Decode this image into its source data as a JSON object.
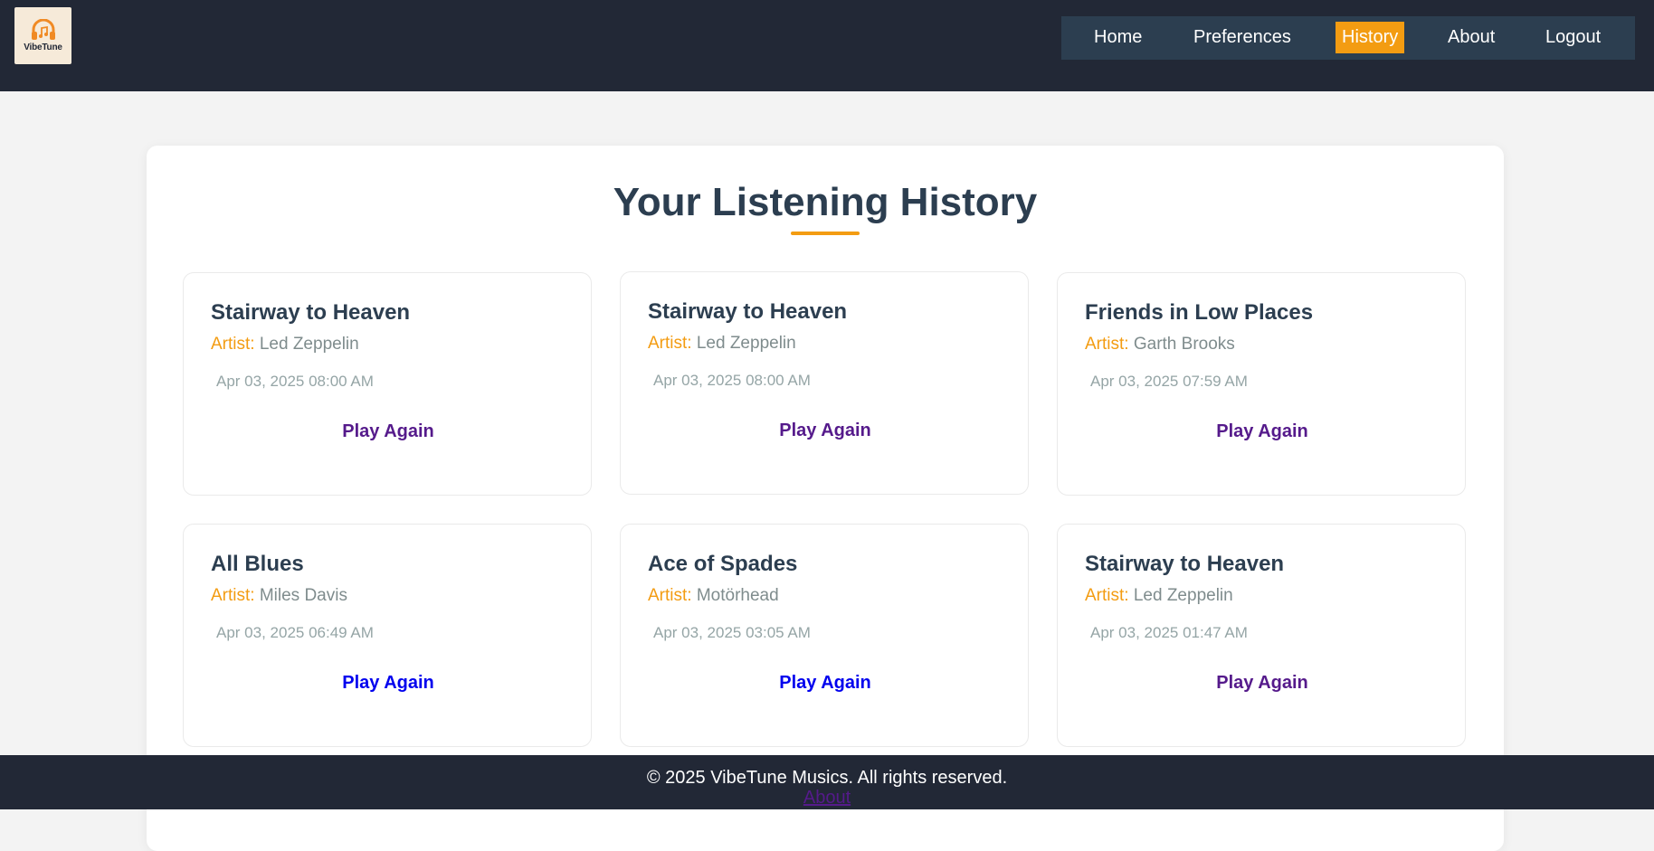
{
  "brand": {
    "logo_text": "VibeTune",
    "logo_icon": "headphones-music-icon"
  },
  "nav": {
    "items": [
      {
        "label": "Home",
        "active": false
      },
      {
        "label": "Preferences",
        "active": false
      },
      {
        "label": "History",
        "active": true
      },
      {
        "label": "About",
        "active": false
      },
      {
        "label": "Logout",
        "active": false
      }
    ]
  },
  "main": {
    "title": "Your Listening History",
    "artist_label": "Artist:",
    "play_again_label": "Play Again",
    "history": [
      {
        "title": "Stairway to Heaven",
        "artist": "Led Zeppelin",
        "played_at": "Apr 03, 2025 08:00 AM",
        "link_visited": true
      },
      {
        "title": "Stairway to Heaven",
        "artist": "Led Zeppelin",
        "played_at": "Apr 03, 2025 08:00 AM",
        "link_visited": true
      },
      {
        "title": "Friends in Low Places",
        "artist": "Garth Brooks",
        "played_at": "Apr 03, 2025 07:59 AM",
        "link_visited": true
      },
      {
        "title": "All Blues",
        "artist": "Miles Davis",
        "played_at": "Apr 03, 2025 06:49 AM",
        "link_visited": false
      },
      {
        "title": "Ace of Spades",
        "artist": "Motörhead",
        "played_at": "Apr 03, 2025 03:05 AM",
        "link_visited": false
      },
      {
        "title": "Stairway to Heaven",
        "artist": "Led Zeppelin",
        "played_at": "Apr 03, 2025 01:47 AM",
        "link_visited": true
      }
    ]
  },
  "footer": {
    "copyright": "© 2025 VibeTune Musics. All rights reserved.",
    "link_label": "About"
  },
  "colors": {
    "header_bg": "#222836",
    "accent": "#f39c12",
    "heading": "#2c3e50",
    "link_unvisited": "#0000ee",
    "link_visited": "#551a8b"
  }
}
